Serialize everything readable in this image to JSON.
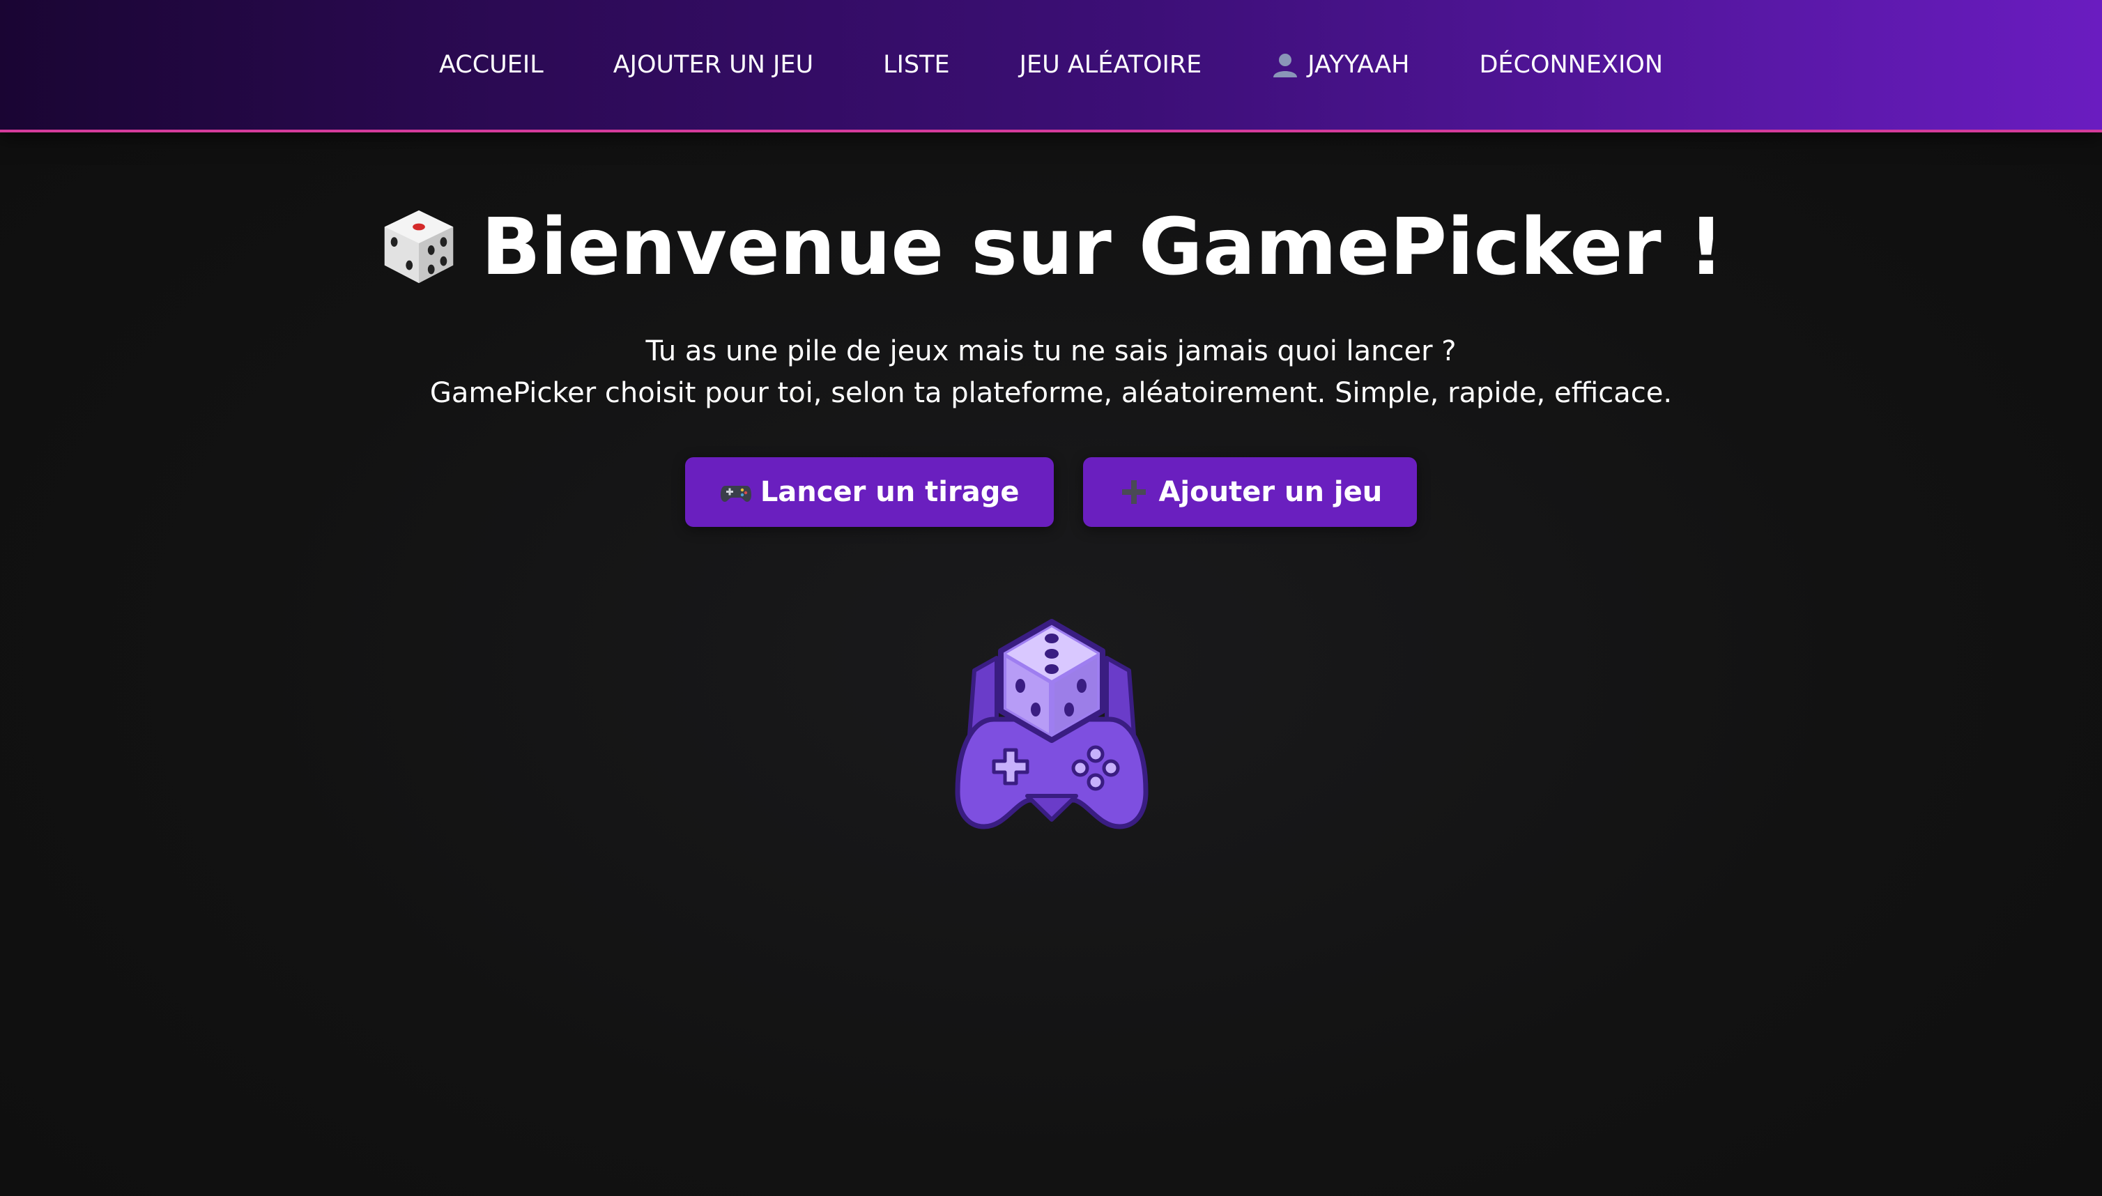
{
  "nav": {
    "items": [
      {
        "label": "ACCUEIL"
      },
      {
        "label": "AJOUTER UN JEU"
      },
      {
        "label": "LISTE"
      },
      {
        "label": "JEU ALÉATOIRE"
      },
      {
        "label": "JAYYAAH",
        "icon": "user-icon"
      },
      {
        "label": "DÉCONNEXION"
      }
    ]
  },
  "hero": {
    "title": "Bienvenue sur GamePicker !",
    "title_icon": "dice-icon",
    "subtitle_line1": "Tu as une pile de jeux mais tu ne sais jamais quoi lancer ?",
    "subtitle_line2": "GamePicker choisit pour toi, selon ta plateforme, aléatoirement. Simple, rapide, efficace."
  },
  "buttons": {
    "draw": {
      "label": "Lancer un tirage",
      "icon": "gamepad-icon"
    },
    "add": {
      "label": "Ajouter un jeu",
      "icon": "plus-icon"
    }
  },
  "logo": {
    "icon": "dice-controller-logo"
  },
  "colors": {
    "accent": "#6a1fbf",
    "nav_border": "#d43b9b",
    "background": "#111111"
  }
}
